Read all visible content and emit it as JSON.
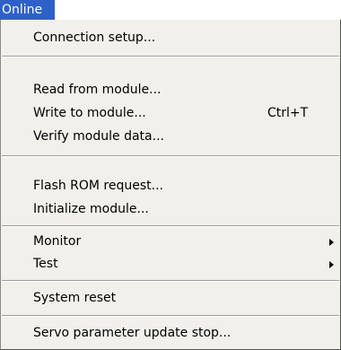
{
  "menu": {
    "title": "Online",
    "items": {
      "connection_setup": "Connection setup...",
      "read_from_module": "Read from module...",
      "write_to_module": "Write to module...",
      "write_to_module_shortcut": "Ctrl+T",
      "verify_module_data": "Verify module data...",
      "flash_rom_request": "Flash ROM request...",
      "initialize_module": "Initialize module...",
      "monitor": "Monitor",
      "test": "Test",
      "system_reset": "System reset",
      "servo_parameter_update_stop": "Servo parameter update stop..."
    }
  },
  "colors": {
    "menu_title_bg": "#2f60c8",
    "menu_bg": "#f1f0ea"
  }
}
